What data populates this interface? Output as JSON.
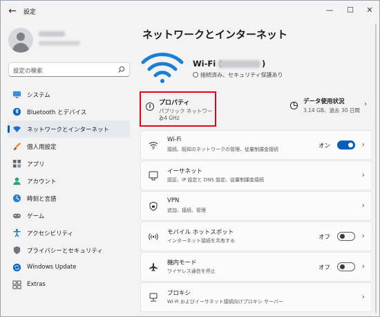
{
  "window": {
    "title": "設定",
    "back_icon": "arrow-left-icon",
    "controls": [
      "minimize-icon",
      "maximize-icon",
      "close-icon"
    ]
  },
  "search": {
    "placeholder": "設定の検索"
  },
  "sidebar": {
    "items": [
      {
        "label": "システム",
        "icon": "system-icon",
        "active": false
      },
      {
        "label": "Bluetooth とデバイス",
        "icon": "bluetooth-icon",
        "active": false
      },
      {
        "label": "ネットワークとインターネット",
        "icon": "network-icon",
        "active": true
      },
      {
        "label": "個人用設定",
        "icon": "brush-icon",
        "active": false
      },
      {
        "label": "アプリ",
        "icon": "apps-icon",
        "active": false
      },
      {
        "label": "アカウント",
        "icon": "account-icon",
        "active": false
      },
      {
        "label": "時刻と言語",
        "icon": "globe-clock-icon",
        "active": false
      },
      {
        "label": "ゲーム",
        "icon": "gamepad-icon",
        "active": false
      },
      {
        "label": "アクセシビリティ",
        "icon": "accessibility-icon",
        "active": false
      },
      {
        "label": "プライバシーとセキュリティ",
        "icon": "shield-icon",
        "active": false
      },
      {
        "label": "Windows Update",
        "icon": "update-icon",
        "active": false
      },
      {
        "label": "Extras",
        "icon": "extras-icon",
        "active": false
      }
    ]
  },
  "main": {
    "title": "ネットワークとインターネット",
    "network": {
      "name": "Wi-Fi (",
      "name_end": ")",
      "status": "接続済み、セキュリティ保護あり"
    },
    "properties": {
      "title": "プロパティ",
      "subtitle": "パブリック ネットワーク",
      "band": "2.4 GHz"
    },
    "usage": {
      "title": "データ使用状況",
      "subtitle": "3.14 GB、過去 30 日間"
    },
    "rows": [
      {
        "title": "Wi-Fi",
        "subtitle": "接続、既知のネットワークの管理、従量制課金接続",
        "icon": "wifi-icon",
        "toggle_label": "オン",
        "toggle": true
      },
      {
        "title": "イーサネット",
        "subtitle": "認証、IP 設定と DNS 設定、従量制課金接続",
        "icon": "ethernet-icon"
      },
      {
        "title": "VPN",
        "subtitle": "追加、接続、管理",
        "icon": "vpn-shield-icon"
      },
      {
        "title": "モバイル ホットスポット",
        "subtitle": "インターネット接続を共有する",
        "icon": "hotspot-icon",
        "toggle_label": "オフ",
        "toggle": false
      },
      {
        "title": "機内モード",
        "subtitle": "ワイヤレス通信を停止",
        "icon": "airplane-icon",
        "toggle_label": "オフ",
        "toggle": false
      },
      {
        "title": "プロキシ",
        "subtitle": "Wi-Fi およびイーサネット接続向けプロキシ サーバー",
        "icon": "proxy-icon"
      }
    ]
  },
  "colors": {
    "accent": "#005fb8",
    "highlight_box": "#e60012",
    "background": "#f3f3f3"
  }
}
